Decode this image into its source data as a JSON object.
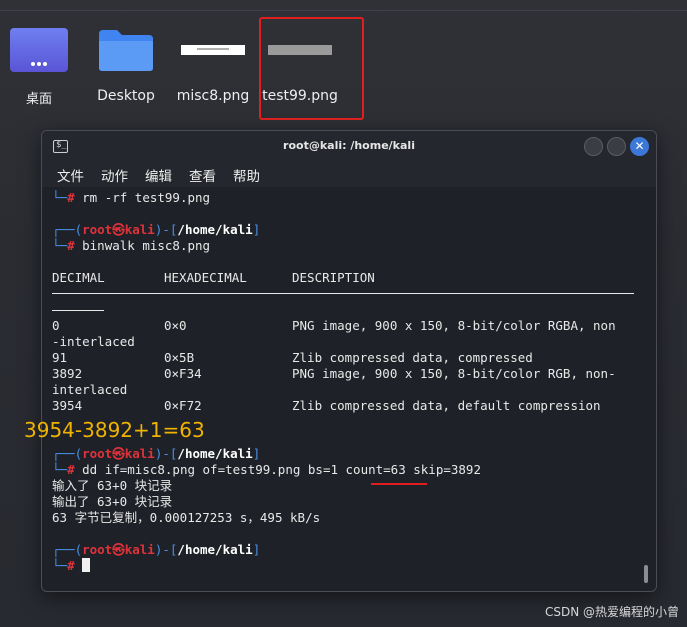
{
  "desktop": {
    "icons": [
      {
        "label": "桌面"
      },
      {
        "label": "Desktop"
      },
      {
        "label": "misc8.png"
      },
      {
        "label": "test99.png"
      }
    ]
  },
  "terminal": {
    "title": "root@kali: /home/kali",
    "menu": [
      "文件",
      "动作",
      "编辑",
      "查看",
      "帮助"
    ],
    "prompt_user": "root",
    "prompt_at": "㉿",
    "prompt_host": "kali",
    "prompt_path": "/home/kali",
    "prompt_symbol": "#",
    "cmd_rm": "rm -rf test99.png",
    "cmd_binwalk": "binwalk misc8.png",
    "table_header": [
      "DECIMAL",
      "HEXADECIMAL",
      "DESCRIPTION"
    ],
    "rows": [
      {
        "decimal": "0",
        "hex": "0×0",
        "desc": "PNG image, 900 x 150, 8-bit/color RGBA, non",
        "wrap": "-interlaced"
      },
      {
        "decimal": "91",
        "hex": "0×5B",
        "desc": "Zlib compressed data, compressed",
        "wrap": ""
      },
      {
        "decimal": "3892",
        "hex": "0×F34",
        "desc": "PNG image, 900 x 150, 8-bit/color RGB, non-",
        "wrap": "interlaced"
      },
      {
        "decimal": "3954",
        "hex": "0×F72",
        "desc": "Zlib compressed data, default compression",
        "wrap": ""
      }
    ],
    "cmd_dd": "dd if=misc8.png of=test99.png bs=1 count=63 skip=3892",
    "output": [
      "输入了 63+0 块记录",
      "输出了 63+0 块记录",
      "63 字节已复制，0.000127253 s，495 kB/s"
    ]
  },
  "annotation": "3954-3892+1=63",
  "watermark": "CSDN @热爱编程的小曾",
  "colors": {
    "accent": "#4a8fe7",
    "prompt_red": "#e0323a",
    "highlight": "#e02020",
    "annotation": "#f0b400"
  }
}
